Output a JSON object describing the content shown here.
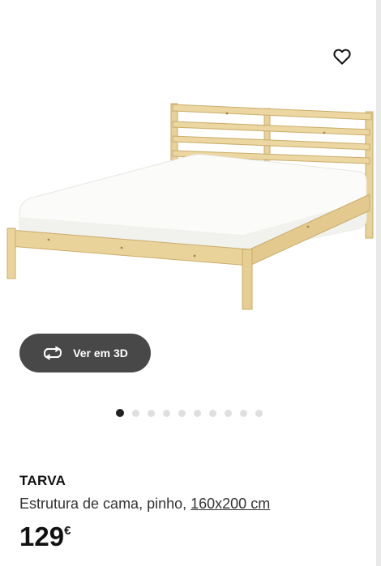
{
  "favorite": {
    "icon": "heart-icon"
  },
  "view3d": {
    "icon": "rotate-3d-icon",
    "label": "Ver em 3D"
  },
  "carousel": {
    "count": 10,
    "active": 0
  },
  "product": {
    "name": "TARVA",
    "description": "Estrutura de cama, pinho, ",
    "size": "160x200 cm",
    "price": "129",
    "currency": "€"
  },
  "colors": {
    "button_bg": "#484848",
    "dot_active": "#222222",
    "dot_inactive": "#dfdfdf"
  }
}
